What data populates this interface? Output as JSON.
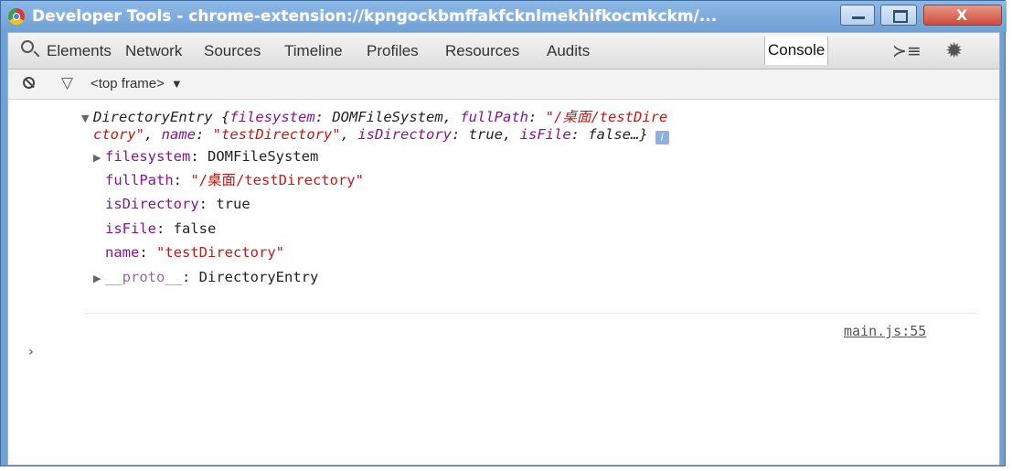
{
  "window": {
    "title": "Developer Tools - chrome-extension://kpngockbmffakfcknlmekhifkocmkckm/...",
    "icon": "chrome-icon"
  },
  "toolbar": {
    "tabs": [
      "Elements",
      "Network",
      "Sources",
      "Timeline",
      "Profiles",
      "Resources",
      "Audits",
      "Console"
    ],
    "active_tab": "Console",
    "icons": [
      "search-icon",
      "show-drawer-icon",
      "settings-gear-icon"
    ]
  },
  "filterbar": {
    "frame": "<top frame>",
    "frame_arrow": "▼",
    "icons": [
      "clear-console-icon",
      "filter-icon"
    ]
  },
  "console": {
    "summary": {
      "arrow": "▼",
      "type": "DirectoryEntry",
      "line1_open": "{",
      "line1_k1": "filesystem",
      "line1_v1": "DOMFileSystem",
      "line1_k2": "fullPath",
      "line1_v2": "\"/桌面/testDire",
      "line2_v2": "ctory\"",
      "line2_k3": "name",
      "line2_v3": "\"testDirectory\"",
      "line2_k4": "isDirectory",
      "line2_v4": "true",
      "line2_k5": "isFile",
      "line2_v5": "false…}",
      "info": "i"
    },
    "props": {
      "filesystem": {
        "arrow": "▶",
        "key": "filesystem",
        "value": "DOMFileSystem"
      },
      "fullPath": {
        "key": "fullPath",
        "value": "\"/桌面/testDirectory\""
      },
      "isDirectory": {
        "key": "isDirectory",
        "value": "true"
      },
      "isFile": {
        "key": "isFile",
        "value": "false"
      },
      "name": {
        "key": "name",
        "value": "\"testDirectory\""
      },
      "proto": {
        "arrow": "▶",
        "key": "__proto__",
        "value": "DirectoryEntry"
      }
    },
    "source": "main.js:55",
    "prompt": "›"
  },
  "colors": {
    "titlebar": "#7aaee0",
    "string": "#c41a16",
    "key": "#881391",
    "prompt": "#3b7fd4"
  }
}
